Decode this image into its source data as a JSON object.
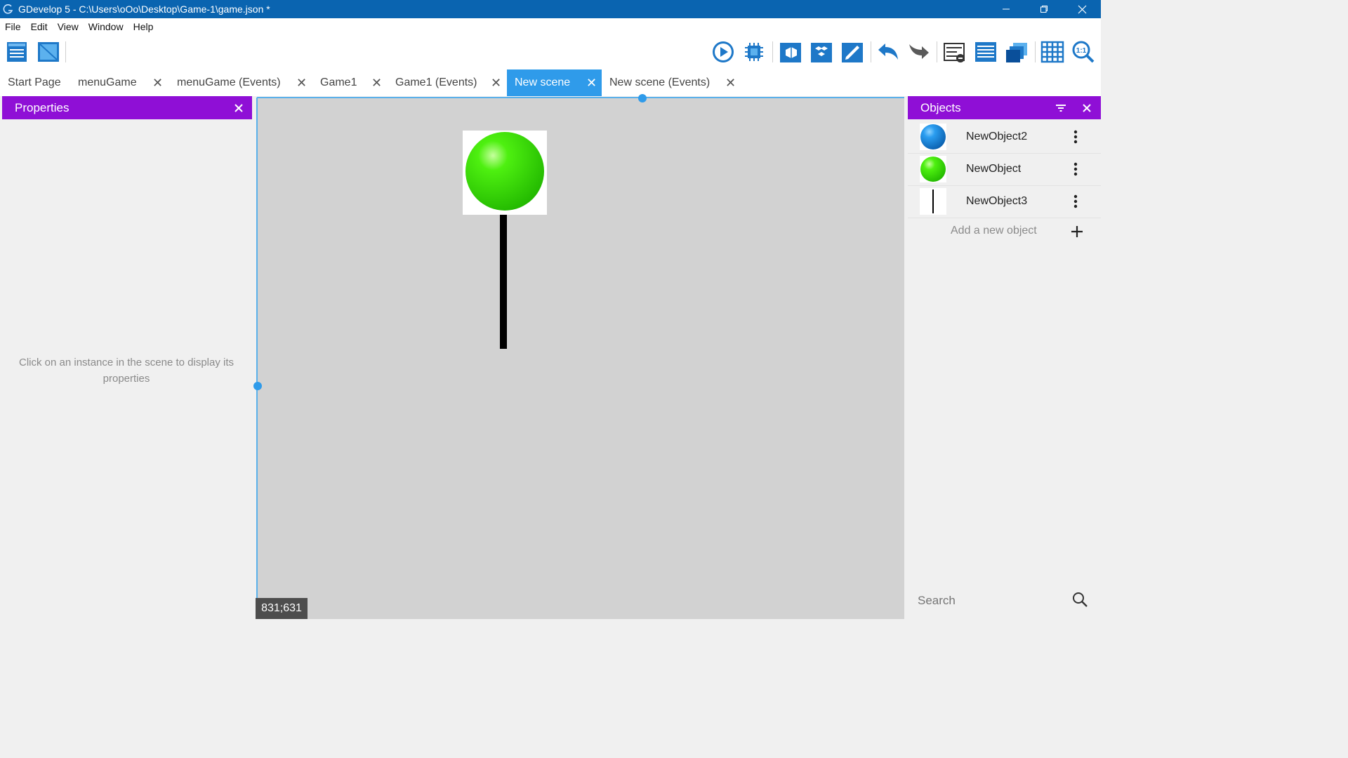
{
  "window": {
    "title": "GDevelop 5 - C:\\Users\\oOo\\Desktop\\Game-1\\game.json *"
  },
  "menu": [
    "File",
    "Edit",
    "View",
    "Window",
    "Help"
  ],
  "tabs": [
    {
      "label": "Start Page",
      "closable": false
    },
    {
      "label": "menuGame",
      "closable": true
    },
    {
      "label": "menuGame (Events)",
      "closable": true
    },
    {
      "label": "Game1",
      "closable": true
    },
    {
      "label": "Game1 (Events)",
      "closable": true
    },
    {
      "label": "New scene",
      "closable": true,
      "active": true
    },
    {
      "label": "New scene (Events)",
      "closable": true
    }
  ],
  "close_glyph": "✕",
  "properties": {
    "title": "Properties",
    "hint": "Click on an instance in the scene to display its properties"
  },
  "scene": {
    "cursor_coords": "831;631"
  },
  "objects": {
    "title": "Objects",
    "items": [
      {
        "name": "NewObject2",
        "icon": "blue-sphere-icon"
      },
      {
        "name": "NewObject",
        "icon": "green-sphere-icon"
      },
      {
        "name": "NewObject3",
        "icon": "black-line-icon"
      }
    ],
    "add_label": "Add a new object",
    "search_placeholder": "Search"
  },
  "colors": {
    "titlebar": "#0a64b0",
    "panel_header": "#8f0fd6",
    "active_tab": "#2f9bea",
    "canvas": "#d2d2d2"
  }
}
